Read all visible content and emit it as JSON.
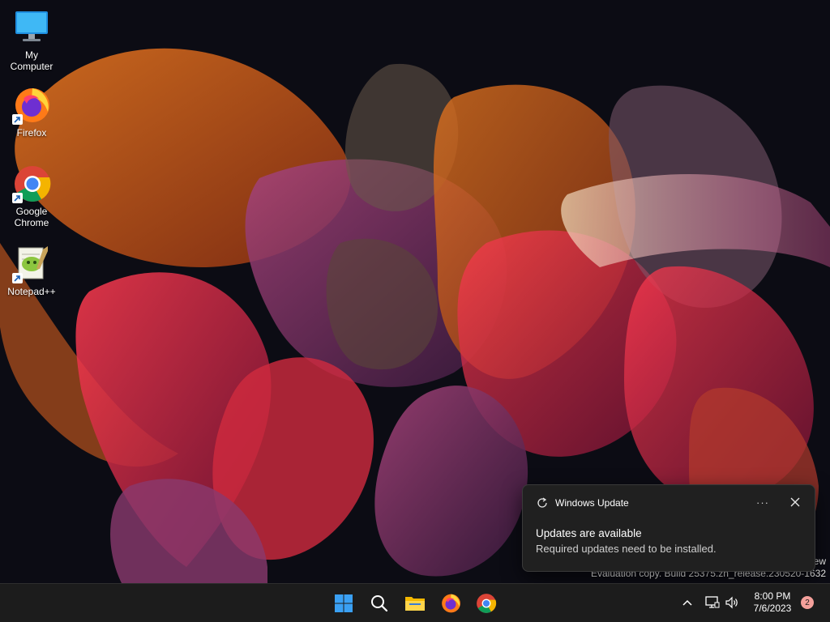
{
  "desktop": {
    "icons": [
      {
        "label": "My Computer",
        "icon": "monitor-icon"
      },
      {
        "label": "Firefox",
        "icon": "firefox-icon"
      },
      {
        "label": "Google\nChrome",
        "icon": "chrome-icon"
      },
      {
        "label": "Notepad++",
        "icon": "notepadplusplus-icon"
      }
    ],
    "watermark": {
      "line1": "ew",
      "line2": "Evaluation copy. Build 25375.zn_release.230520-1632"
    }
  },
  "toast": {
    "app_name": "Windows Update",
    "app_icon": "refresh-icon",
    "more_label": "···",
    "title": "Updates are available",
    "body": "Required updates need to be installed."
  },
  "taskbar": {
    "pinned": [
      {
        "name": "start",
        "icon": "windows-logo-icon"
      },
      {
        "name": "search",
        "icon": "search-icon"
      },
      {
        "name": "file-explorer",
        "icon": "folder-icon"
      },
      {
        "name": "firefox",
        "icon": "firefox-icon"
      },
      {
        "name": "chrome",
        "icon": "chrome-icon"
      }
    ],
    "tray": {
      "time": "8:00 PM",
      "date": "7/6/2023",
      "notification_count": "2"
    }
  },
  "colors": {
    "taskbar_bg": "#1c1c1c",
    "toast_bg": "#202020",
    "start_blue": "#3aa0f3",
    "badge": "#f4a09b"
  }
}
